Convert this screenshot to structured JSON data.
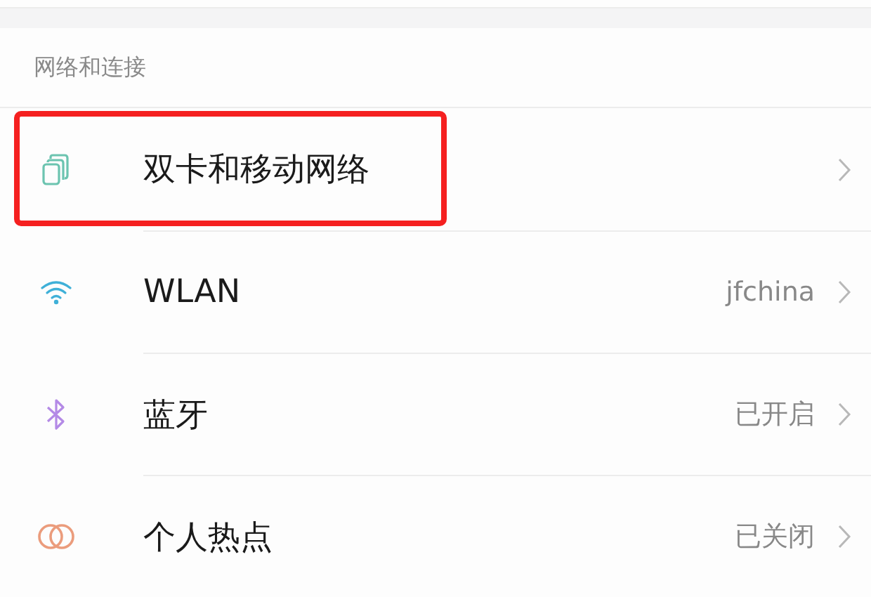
{
  "section": {
    "title": "网络和连接"
  },
  "items": [
    {
      "kind": "sim",
      "label": "双卡和移动网络",
      "highlighted": true
    },
    {
      "kind": "wifi",
      "label": "WLAN",
      "value": "jfchina",
      "highlighted": false
    },
    {
      "kind": "bluetooth",
      "label": "蓝牙",
      "value": "已开启",
      "highlighted": false
    },
    {
      "kind": "hotspot",
      "label": "个人热点",
      "value": "已关闭",
      "highlighted": false
    }
  ]
}
